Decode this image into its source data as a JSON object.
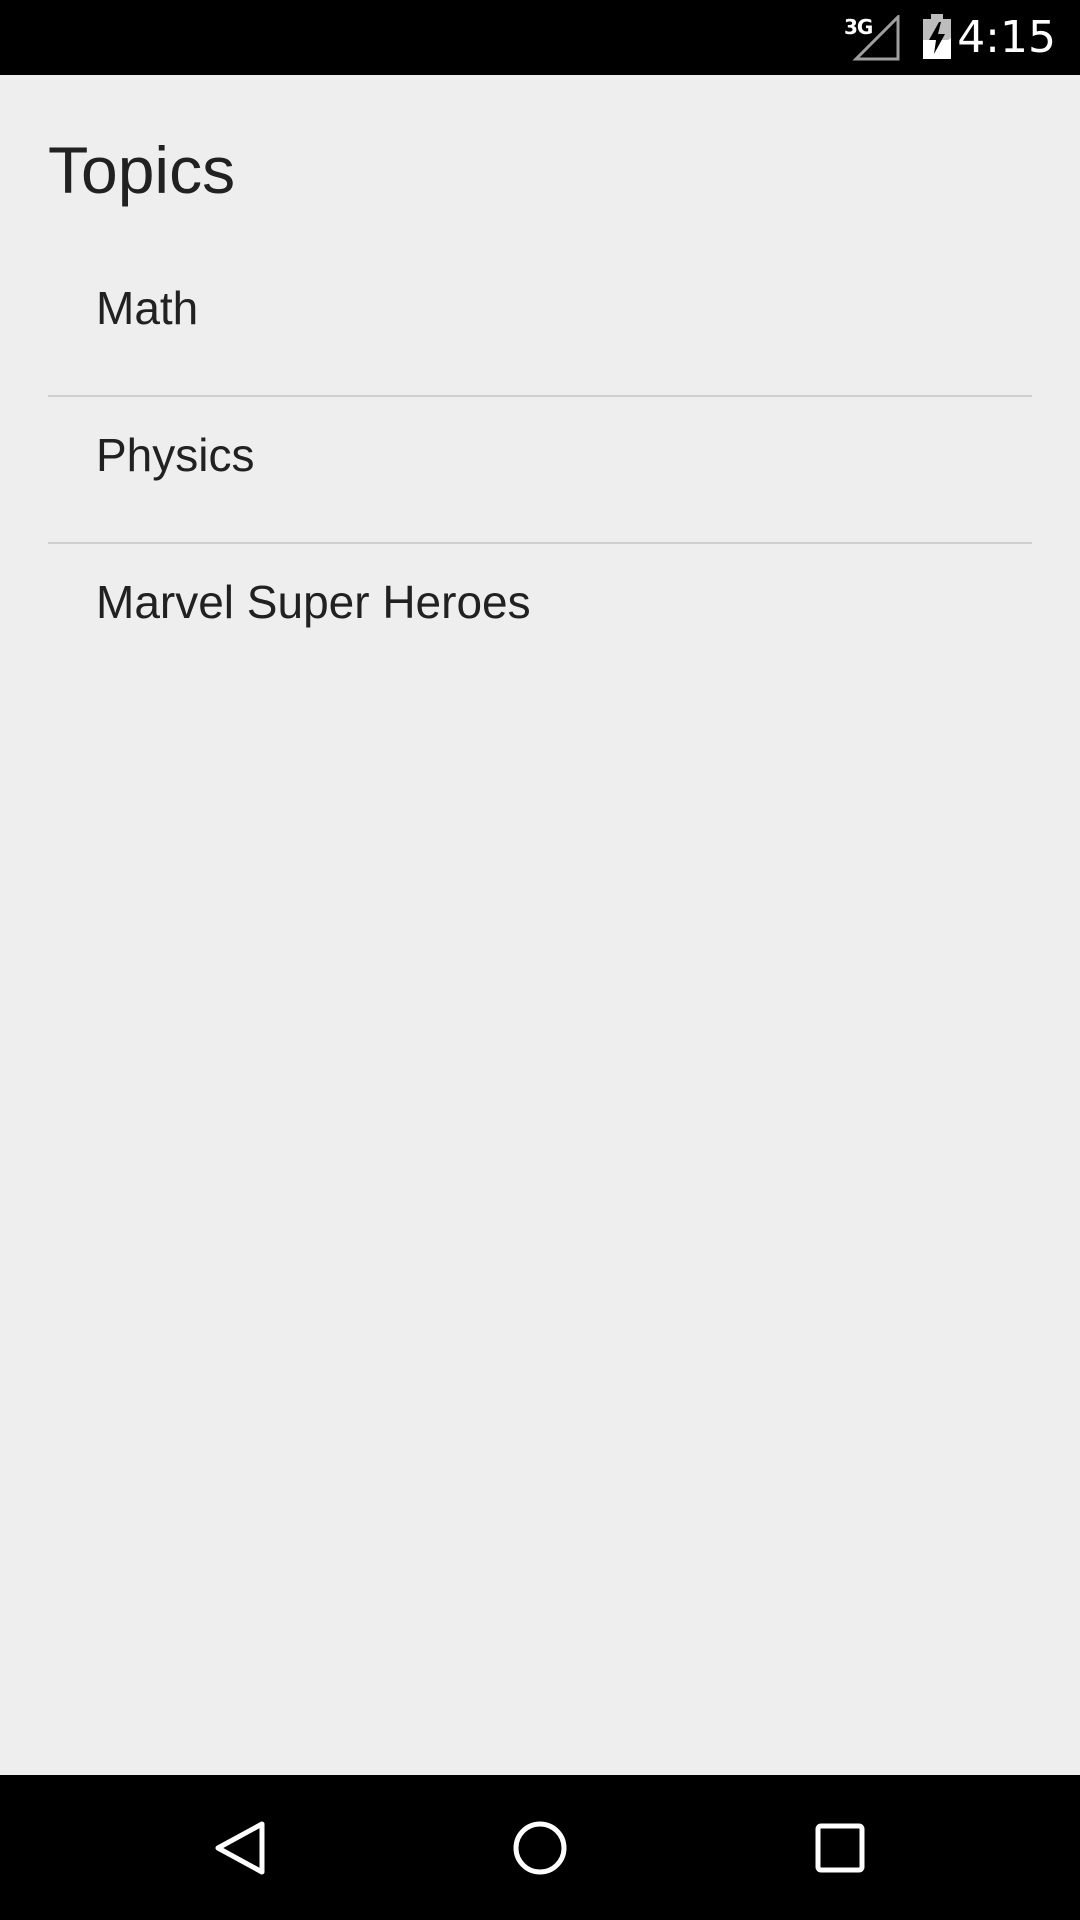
{
  "status_bar": {
    "network": "3G",
    "time": "4:15",
    "signal_icon": "cell-signal-icon",
    "battery_icon": "battery-charging-icon"
  },
  "page": {
    "title": "Topics"
  },
  "topics": [
    {
      "label": "Math"
    },
    {
      "label": "Physics"
    },
    {
      "label": "Marvel Super Heroes"
    }
  ],
  "nav_bar": {
    "back_icon": "back-icon",
    "home_icon": "home-icon",
    "recents_icon": "recents-icon"
  },
  "colors": {
    "background": "#eeeeee",
    "text": "#212121",
    "divider": "#cfcfcf",
    "bars": "#000000"
  }
}
